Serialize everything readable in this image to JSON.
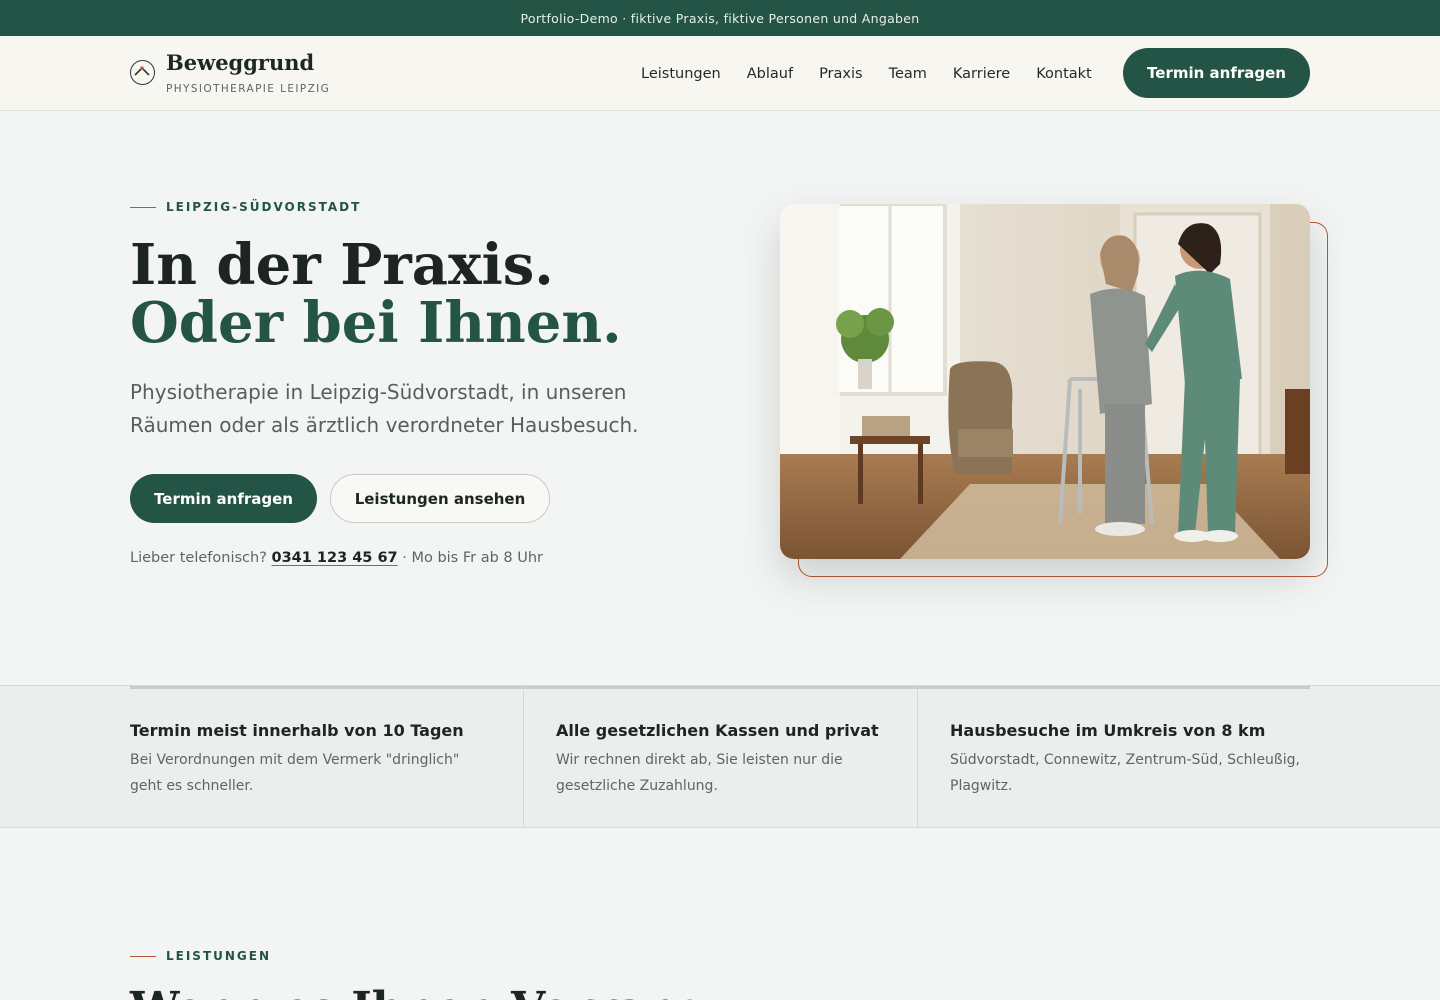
{
  "topbar": {
    "text": "Portfolio-Demo · fiktive Praxis, fiktive Personen und Angaben"
  },
  "brand": {
    "name": "Beweggrund",
    "tagline": "PHYSIOTHERAPIE LEIPZIG",
    "logo_icon": "mountain-circle-icon"
  },
  "nav": {
    "items": [
      "Leistungen",
      "Ablauf",
      "Praxis",
      "Team",
      "Karriere",
      "Kontakt"
    ],
    "cta": "Termin anfragen"
  },
  "hero": {
    "eyebrow": "LEIPZIG-SÜDVORSTADT",
    "title_line1": "In der Praxis.",
    "title_line2": "Oder bei Ihnen.",
    "lead": "Physiotherapie in Leipzig-Südvorstadt, in unseren Räumen oder als ärztlich verordneter Hausbesuch.",
    "primary_button": "Termin anfragen",
    "secondary_button": "Leistungen ansehen",
    "phone_prefix": "Lieber telefonisch?",
    "phone_number": "0341 123 45 67",
    "phone_suffix": "· Mo bis Fr ab 8 Uhr"
  },
  "features": [
    {
      "title": "Termin meist innerhalb von 10 Tagen",
      "text": "Bei Verordnungen mit dem Vermerk \"dringlich\" geht es schneller."
    },
    {
      "title": "Alle gesetzlichen Kassen und privat",
      "text": "Wir rechnen direkt ab, Sie leisten nur die gesetzliche Zuzahlung."
    },
    {
      "title": "Hausbesuche im Umkreis von 8 km",
      "text": "Südvorstadt, Connewitz, Zentrum-Süd, Schleußig, Plagwitz."
    }
  ],
  "services": {
    "eyebrow": "LEISTUNGEN",
    "title": "Wenn es Ihnen Vorrang"
  },
  "colors": {
    "brand_green": "#245446",
    "accent_terracotta": "#b9553a",
    "background": "#f3f5f4"
  }
}
